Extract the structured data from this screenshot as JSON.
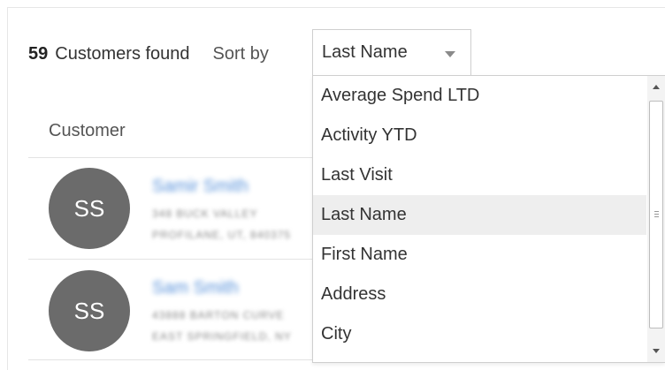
{
  "results": {
    "count": "59",
    "label": "Customers found"
  },
  "sort": {
    "label": "Sort by",
    "selected": "Last Name",
    "options": [
      {
        "label": "Average Spend LTD",
        "selected": false
      },
      {
        "label": "Activity YTD",
        "selected": false
      },
      {
        "label": "Last Visit",
        "selected": false
      },
      {
        "label": "Last Name",
        "selected": true
      },
      {
        "label": "First Name",
        "selected": false
      },
      {
        "label": "Address",
        "selected": false
      },
      {
        "label": "City",
        "selected": false
      }
    ]
  },
  "table": {
    "header": "Customer"
  },
  "customers": [
    {
      "initials": "SS",
      "name": "Samir Smith",
      "address_line1": "348 BUCK VALLEY",
      "address_line2": "PROFILANE, UT, 840375"
    },
    {
      "initials": "SS",
      "name": "Sam Smith",
      "address_line1": "43888 BARTON CURVE",
      "address_line2": "EAST SPRINGFIELD, NY"
    }
  ],
  "colors": {
    "avatar": "#6b6b6b",
    "link": "#3b7fd4",
    "selected_option_bg": "#eeeeee"
  }
}
